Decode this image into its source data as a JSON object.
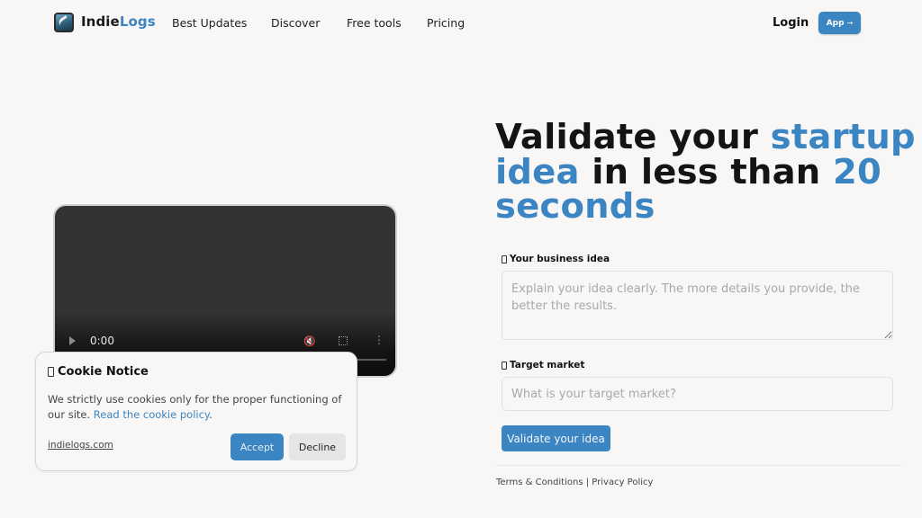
{
  "header": {
    "brand_part1": "Indie",
    "brand_part2": "Logs",
    "nav": [
      "Best Updates",
      "Discover",
      "Free tools",
      "Pricing"
    ],
    "login_label": "Login",
    "app_label": "App",
    "app_arrow": "→"
  },
  "hero": {
    "title_parts": [
      {
        "text": "Validate your ",
        "accent": false
      },
      {
        "text": "startup",
        "accent": true
      },
      {
        "text": "idea",
        "accent": true
      },
      {
        "text": " in less than ",
        "accent": false
      },
      {
        "text": "20",
        "accent": true
      },
      {
        "text": "seconds",
        "accent": true
      }
    ]
  },
  "form": {
    "idea_label": "Your business idea",
    "idea_placeholder": "Explain your idea clearly. The more details you provide, the better the results.",
    "market_label": "Target market",
    "market_placeholder": "What is your target market?",
    "submit_label": "Validate your idea"
  },
  "footer": {
    "terms": "Terms & Conditions",
    "separator": "|",
    "privacy": "Privacy Policy"
  },
  "video": {
    "time": "0:00",
    "mute_icon": "🔇",
    "more_icon": "⋮"
  },
  "cookie": {
    "title": "Cookie Notice",
    "text": "We strictly use cookies only for the proper functioning of our site. ",
    "link": "Read the cookie policy",
    "link_suffix": ".",
    "site": "indielogs.com",
    "accept": "Accept",
    "decline": "Decline"
  },
  "colors": {
    "accent": "#3a85c2",
    "background": "#f8f7f6",
    "text": "#141414"
  }
}
